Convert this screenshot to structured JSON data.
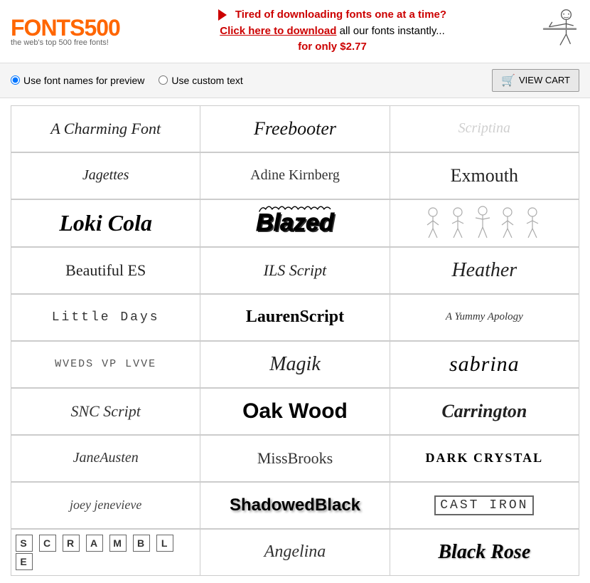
{
  "header": {
    "logo": "FONTS",
    "logo_number": "500",
    "logo_sub": "the web's top 500 free fonts!",
    "promo_tired": "Tired of downloading fonts one at a time?",
    "promo_link": "Click here to download",
    "promo_all": " all our fonts instantly...",
    "promo_price": "for only $2.77"
  },
  "controls": {
    "radio1_label": "Use font names for preview",
    "radio2_label": "Use custom text",
    "view_cart_label": "VIEW CART"
  },
  "fonts": [
    {
      "name": "A Charming Font",
      "style": "charming"
    },
    {
      "name": "Freebooter",
      "style": "freebooter"
    },
    {
      "name": "Scriptina",
      "style": "scriptina"
    },
    {
      "name": "Jagettes",
      "style": "jagettes"
    },
    {
      "name": "Adine Kirnberg",
      "style": "adine"
    },
    {
      "name": "Exmouth",
      "style": "exmouth"
    },
    {
      "name": "Loki Cola",
      "style": "lokicola"
    },
    {
      "name": "Blazed",
      "style": "blazed"
    },
    {
      "name": "✦ characters ✦",
      "style": "characters"
    },
    {
      "name": "Beautiful ES",
      "style": "beautifulest"
    },
    {
      "name": "ILS Script",
      "style": "ilsscript"
    },
    {
      "name": "Heather",
      "style": "heather"
    },
    {
      "name": "Little Days",
      "style": "littledays"
    },
    {
      "name": "LaurenScript",
      "style": "laurenscript"
    },
    {
      "name": "A Yummy Apology",
      "style": "ayummy"
    },
    {
      "name": "WVEDS VP LVVE",
      "style": "wveds"
    },
    {
      "name": "Magik",
      "style": "magik"
    },
    {
      "name": "sabrina",
      "style": "sabrina"
    },
    {
      "name": "SNC Script",
      "style": "sncscript"
    },
    {
      "name": "Oak Wood",
      "style": "oakwood"
    },
    {
      "name": "Carrington",
      "style": "carrington"
    },
    {
      "name": "JaneAusten",
      "style": "janeausten"
    },
    {
      "name": "MissBrooks",
      "style": "missbrooks"
    },
    {
      "name": "DARK CRYSTAL",
      "style": "darkcrystal"
    },
    {
      "name": "joey jenevieve",
      "style": "joeyjenevieve"
    },
    {
      "name": "ShadowedBlack",
      "style": "shadowedblack"
    },
    {
      "name": "CAST IRON",
      "style": "castiron"
    },
    {
      "name": "SCRAMBLE",
      "style": "scramble"
    },
    {
      "name": "Angelina",
      "style": "angelina"
    },
    {
      "name": "Black Rose",
      "style": "blackrose"
    }
  ]
}
